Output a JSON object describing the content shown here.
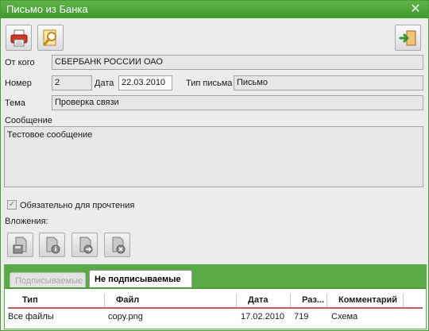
{
  "window": {
    "title": "Письмо из Банка"
  },
  "toolbar": {
    "print_icon": "printer-icon",
    "preview_icon": "magnifier-icon",
    "exit_icon": "exit-door-icon"
  },
  "form": {
    "from_label": "От кого",
    "from_value": "СБЕРБАНК РОССИИ ОАО",
    "number_label": "Номер",
    "number_value": "2",
    "date_label": "Дата",
    "date_value": "22.03.2010",
    "type_label": "Тип письма",
    "type_value": "Письмо",
    "subject_label": "Тема",
    "subject_value": "Проверка связи",
    "message_label": "Сообщение",
    "message_value": "Тестовое сообщение",
    "mandatory_label": "Обязательно для прочтения",
    "mandatory_checked": true,
    "attachments_label": "Вложения:"
  },
  "tabs": [
    {
      "label": "Подписываемые",
      "active": false
    },
    {
      "label": "Не подписываемые",
      "active": true
    }
  ],
  "grid": {
    "columns": [
      "Тип",
      "Файл",
      "Дата",
      "Раз...",
      "Комментарий"
    ],
    "rows": [
      [
        "Все файлы",
        "copy.png",
        "17.02.2010",
        "719",
        "Схема"
      ]
    ]
  },
  "colors": {
    "accent": "#4ea53a",
    "header_underline": "#c85a5a"
  }
}
